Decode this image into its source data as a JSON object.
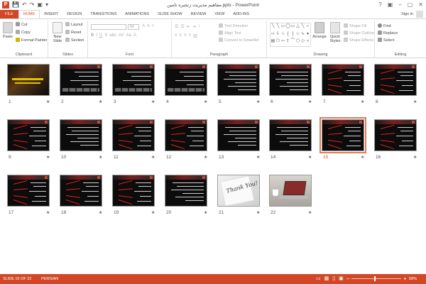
{
  "window": {
    "title": "مفاهیم مدیریت زنجیره تامین.pptx - PowerPoint",
    "app_icon_letter": "P",
    "qat": [
      "💾",
      "↶",
      "↷",
      "▣",
      "▾"
    ],
    "controls": [
      "?",
      "▣",
      "–",
      "▢",
      "✕"
    ]
  },
  "tabs": [
    {
      "label": "FILE",
      "kind": "file"
    },
    {
      "label": "HOME",
      "kind": "active"
    },
    {
      "label": "INSERT",
      "kind": ""
    },
    {
      "label": "DESIGN",
      "kind": ""
    },
    {
      "label": "TRANSITIONS",
      "kind": ""
    },
    {
      "label": "ANIMATIONS",
      "kind": ""
    },
    {
      "label": "SLIDE SHOW",
      "kind": ""
    },
    {
      "label": "REVIEW",
      "kind": ""
    },
    {
      "label": "VIEW",
      "kind": ""
    },
    {
      "label": "ADD-INS",
      "kind": ""
    }
  ],
  "account": {
    "signin": "Sign in"
  },
  "ribbon": {
    "clipboard": {
      "label": "Clipboard",
      "paste": "Paste",
      "cut": "Cut",
      "copy": "Copy",
      "format_painter": "Format Painter"
    },
    "slides": {
      "label": "Slides",
      "new_slide": "New Slide",
      "layout": "Layout",
      "reset": "Reset",
      "section": "Section"
    },
    "font": {
      "label": "Font",
      "size": "54"
    },
    "paragraph": {
      "label": "Paragraph",
      "text_direction": "Text Direction",
      "align_text": "Align Text",
      "smartart": "Convert to SmartArt"
    },
    "drawing": {
      "label": "Drawing",
      "arrange": "Arrange",
      "quick_styles": "Quick Styles",
      "shape_fill": "Shape Fill",
      "shape_outline": "Shape Outline",
      "shape_effects": "Shape Effects"
    },
    "editing": {
      "label": "Editing",
      "find": "Find",
      "replace": "Replace",
      "select": "Select"
    }
  },
  "slides": [
    {
      "num": "1",
      "type": "title"
    },
    {
      "num": "2",
      "type": "pics"
    },
    {
      "num": "3",
      "type": "pics"
    },
    {
      "num": "4",
      "type": "pics"
    },
    {
      "num": "5",
      "type": "text"
    },
    {
      "num": "6",
      "type": "text"
    },
    {
      "num": "7",
      "type": "diagram"
    },
    {
      "num": "8",
      "type": "diagram"
    },
    {
      "num": "9",
      "type": "diagram"
    },
    {
      "num": "10",
      "type": "text"
    },
    {
      "num": "11",
      "type": "diagram"
    },
    {
      "num": "12",
      "type": "diagram"
    },
    {
      "num": "13",
      "type": "text"
    },
    {
      "num": "14",
      "type": "text"
    },
    {
      "num": "15",
      "type": "diagram",
      "selected": true
    },
    {
      "num": "16",
      "type": "diagram"
    },
    {
      "num": "17",
      "type": "diagram"
    },
    {
      "num": "18",
      "type": "diagram"
    },
    {
      "num": "19",
      "type": "diagram"
    },
    {
      "num": "20",
      "type": "text"
    },
    {
      "num": "21",
      "type": "thanks"
    },
    {
      "num": "22",
      "type": "laptop"
    }
  ],
  "thanks_text": "Thank You!",
  "status": {
    "slide": "SLIDE 15 OF 22",
    "language": "PERSIAN",
    "zoom": "58%",
    "zoom_fraction": 0.58
  },
  "colors": {
    "accent": "#d24726"
  }
}
